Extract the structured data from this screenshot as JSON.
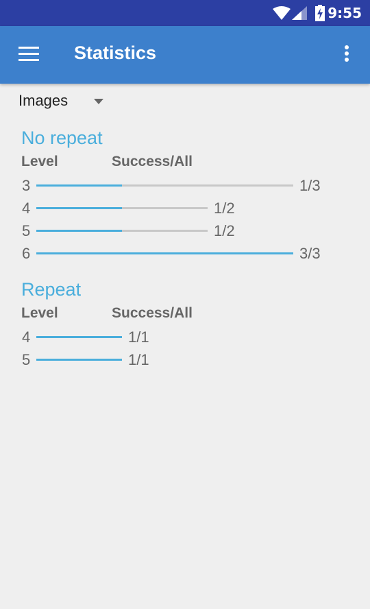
{
  "status_bar": {
    "time": "9:55",
    "icons": [
      "wifi-icon",
      "cell-signal-icon",
      "battery-charging-icon"
    ]
  },
  "app_bar": {
    "title": "Statistics",
    "menu_icon": "hamburger-menu-icon",
    "overflow_icon": "more-vert-icon"
  },
  "filter": {
    "selected": "Images"
  },
  "colors": {
    "status_bar": "#2c3fa3",
    "app_bar": "#3d80cc",
    "accent": "#4aaedc",
    "track": "#c8c8c8"
  },
  "sections": [
    {
      "title": "No repeat",
      "header_level": "Level",
      "header_success": "Success/All",
      "rows": [
        {
          "level": "3",
          "success": 1,
          "all": 3,
          "ratio": "1/3"
        },
        {
          "level": "4",
          "success": 1,
          "all": 2,
          "ratio": "1/2"
        },
        {
          "level": "5",
          "success": 1,
          "all": 2,
          "ratio": "1/2"
        },
        {
          "level": "6",
          "success": 3,
          "all": 3,
          "ratio": "3/3"
        }
      ]
    },
    {
      "title": "Repeat",
      "header_level": "Level",
      "header_success": "Success/All",
      "rows": [
        {
          "level": "4",
          "success": 1,
          "all": 1,
          "ratio": "1/1"
        },
        {
          "level": "5",
          "success": 1,
          "all": 1,
          "ratio": "1/1"
        }
      ]
    }
  ]
}
